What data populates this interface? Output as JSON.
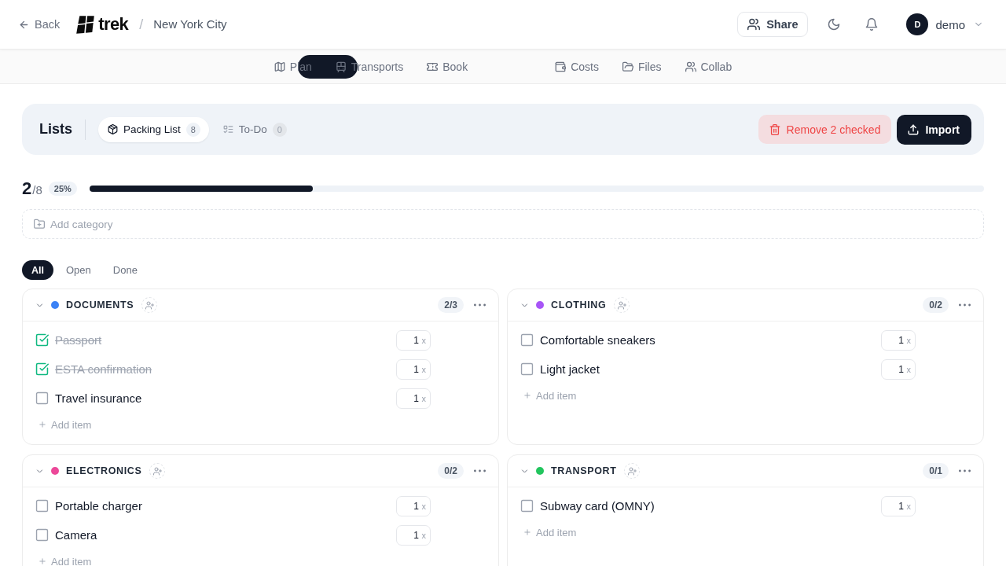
{
  "header": {
    "back_label": "Back",
    "logo_text": "trek",
    "separator": "/",
    "trip_name": "New York City",
    "share_label": "Share",
    "user": {
      "initial": "D",
      "name": "demo"
    }
  },
  "nav_tabs": [
    {
      "label": "Plan",
      "selected": false
    },
    {
      "label": "Transports",
      "selected": false
    },
    {
      "label": "Book",
      "selected": false
    },
    {
      "label": "Costs",
      "selected": false
    },
    {
      "label": "Files",
      "selected": false
    },
    {
      "label": "Collab",
      "selected": false
    }
  ],
  "lists": {
    "title": "Lists",
    "tabs": [
      {
        "label": "Packing List",
        "count": "8",
        "selected": true
      },
      {
        "label": "To-Do",
        "count": "0",
        "selected": false
      }
    ],
    "remove_checked_label": "Remove 2 checked",
    "import_label": "Import"
  },
  "progress": {
    "done": "2",
    "total": "/8",
    "percent": "25%",
    "level": 0.25
  },
  "add_category_label": "Add category",
  "filters": [
    {
      "label": "All",
      "selected": true
    },
    {
      "label": "Open",
      "selected": false
    },
    {
      "label": "Done",
      "selected": false
    }
  ],
  "categories": [
    {
      "name": "DOCUMENTS",
      "color": "#3b82f6",
      "count": "2/3",
      "expanded": true,
      "items": [
        {
          "name": "Passport",
          "checked": true,
          "quantity": "1",
          "unit": "x"
        },
        {
          "name": "ESTA confirmation",
          "checked": true,
          "quantity": "1",
          "unit": "x"
        },
        {
          "name": "Travel insurance",
          "checked": false,
          "quantity": "1",
          "unit": "x"
        }
      ],
      "add_label": "Add item"
    },
    {
      "name": "CLOTHING",
      "color": "#a855f7",
      "count": "0/2",
      "expanded": true,
      "items": [
        {
          "name": "Comfortable sneakers",
          "checked": false,
          "quantity": "1",
          "unit": "x"
        },
        {
          "name": "Light jacket",
          "checked": false,
          "quantity": "1",
          "unit": "x"
        }
      ],
      "add_label": "Add item"
    },
    {
      "name": "ELECTRONICS",
      "color": "#ec4899",
      "count": "0/2",
      "expanded": true,
      "items": [
        {
          "name": "Portable charger",
          "checked": false,
          "quantity": "1",
          "unit": "x"
        },
        {
          "name": "Camera",
          "checked": false,
          "quantity": "1",
          "unit": "x"
        }
      ],
      "add_label": "Add item"
    },
    {
      "name": "TRANSPORT",
      "color": "#22c55e",
      "count": "0/1",
      "expanded": true,
      "items": [
        {
          "name": "Subway card (OMNY)",
          "checked": false,
          "quantity": "1",
          "unit": "x"
        }
      ],
      "add_label": "Add item"
    }
  ]
}
